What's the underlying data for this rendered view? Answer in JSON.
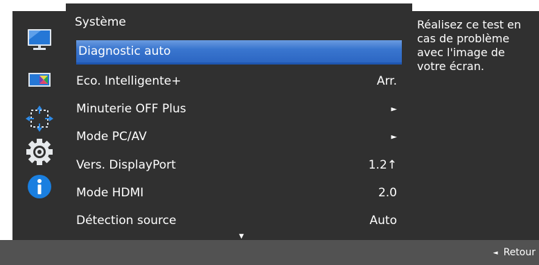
{
  "menu": {
    "title": "Système",
    "items": [
      {
        "label": "Diagnostic auto",
        "value": "",
        "selected": true
      },
      {
        "label": "Eco. Intelligente+",
        "value": "Arr."
      },
      {
        "label": "Minuterie OFF Plus",
        "value": "►"
      },
      {
        "label": "Mode PC/AV",
        "value": "►"
      },
      {
        "label": "Vers. DisplayPort",
        "value": "1.2↑"
      },
      {
        "label": "Mode HDMI",
        "value": "2.0"
      },
      {
        "label": "Détection source",
        "value": "Auto"
      }
    ],
    "scroll_indicator": "▼"
  },
  "sidebar": {
    "icons": [
      "picture-icon",
      "color-icon",
      "screen-size-icon",
      "system-gear-icon",
      "information-icon"
    ],
    "active": "system-gear-icon"
  },
  "help": {
    "text": "Réalisez ce test en cas de problème avec l'image de votre écran."
  },
  "footer": {
    "back_label": "Retour",
    "back_arrow": "◄"
  },
  "colors": {
    "panel": "#303030",
    "footer": "#525252",
    "highlight": "#3a76cf",
    "info_blue": "#1a7fe0"
  }
}
